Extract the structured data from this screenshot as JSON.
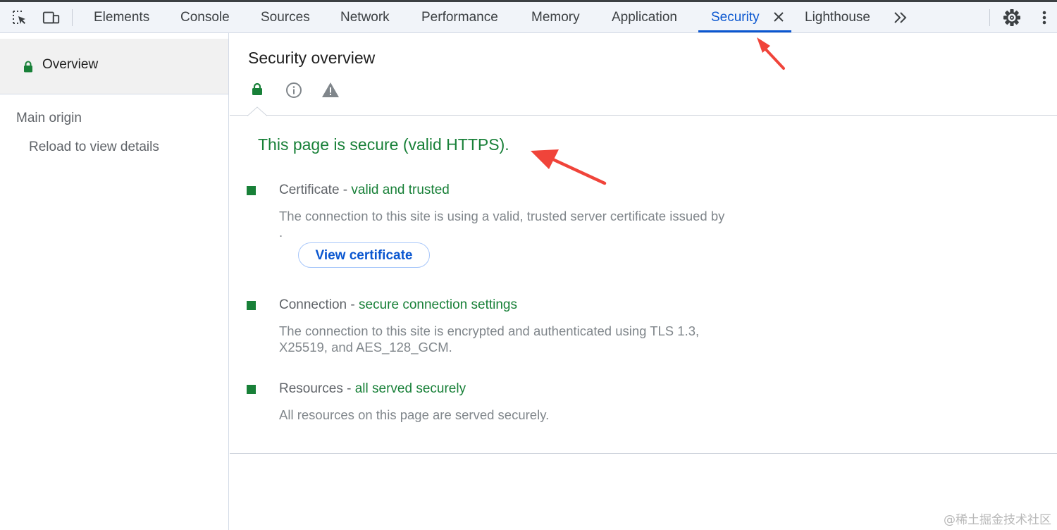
{
  "toolbar": {
    "inspect_icon": "element-picker-icon",
    "device_icon": "device-toolbar-icon",
    "tabs": [
      {
        "label": "Elements"
      },
      {
        "label": "Console"
      },
      {
        "label": "Sources"
      },
      {
        "label": "Network"
      },
      {
        "label": "Performance"
      },
      {
        "label": "Memory"
      },
      {
        "label": "Application"
      },
      {
        "label": "Security",
        "active": true
      },
      {
        "label": "Lighthouse"
      }
    ],
    "more_tabs_icon": "chevron-double-right-icon",
    "settings_icon": "gear-icon",
    "menu_icon": "kebab-menu-icon",
    "active_color": "#0b57d0"
  },
  "sidebar": {
    "overview_label": "Overview",
    "main_origin_label": "Main origin",
    "reload_label": "Reload to view details"
  },
  "main": {
    "title": "Security overview",
    "summary_icons": [
      "lock-icon",
      "info-icon",
      "warning-icon"
    ],
    "summary_text": "This page is secure (valid HTTPS).",
    "secure_color": "#188038",
    "sections": [
      {
        "name": "Certificate",
        "separator": " - ",
        "status": "valid and trusted",
        "description": "The connection to this site is using a valid, trusted server certificate issued by ."
      },
      {
        "name": "Connection",
        "separator": " - ",
        "status": "secure connection settings",
        "description": "The connection to this site is encrypted and authenticated using TLS 1.3, X25519, and AES_128_GCM."
      },
      {
        "name": "Resources",
        "separator": " - ",
        "status": "all served securely",
        "description": "All resources on this page are served securely."
      }
    ],
    "view_certificate_label": "View certificate"
  },
  "annotations": {
    "arrow_color": "#f0443a"
  },
  "watermark": "@稀土掘金技术社区"
}
